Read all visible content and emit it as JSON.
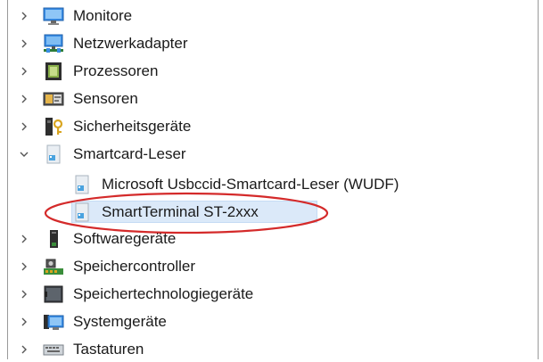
{
  "tree": {
    "items": [
      {
        "label": "Monitore",
        "icon": "monitor-icon",
        "expanded": false
      },
      {
        "label": "Netzwerkadapter",
        "icon": "network-adapter-icon",
        "expanded": false
      },
      {
        "label": "Prozessoren",
        "icon": "processor-icon",
        "expanded": false
      },
      {
        "label": "Sensoren",
        "icon": "sensor-icon",
        "expanded": false
      },
      {
        "label": "Sicherheitsgeräte",
        "icon": "security-device-icon",
        "expanded": false
      },
      {
        "label": "Smartcard-Leser",
        "icon": "smartcard-reader-icon",
        "expanded": true,
        "children": [
          {
            "label": "Microsoft Usbccid-Smartcard-Leser (WUDF)",
            "icon": "smartcard-reader-icon"
          },
          {
            "label": "SmartTerminal ST-2xxx",
            "icon": "smartcard-reader-icon",
            "selected": true
          }
        ]
      },
      {
        "label": "Softwaregeräte",
        "icon": "software-device-icon",
        "expanded": false
      },
      {
        "label": "Speichercontroller",
        "icon": "storage-controller-icon",
        "expanded": false
      },
      {
        "label": "Speichertechnologiegeräte",
        "icon": "memory-technology-icon",
        "expanded": false
      },
      {
        "label": "Systemgeräte",
        "icon": "system-device-icon",
        "expanded": false
      },
      {
        "label": "Tastaturen",
        "icon": "keyboard-icon",
        "expanded": false
      }
    ]
  },
  "colors": {
    "selection": "#dbe9f9",
    "highlight_ellipse": "#d42a2a",
    "text": "#1a1a1a"
  }
}
